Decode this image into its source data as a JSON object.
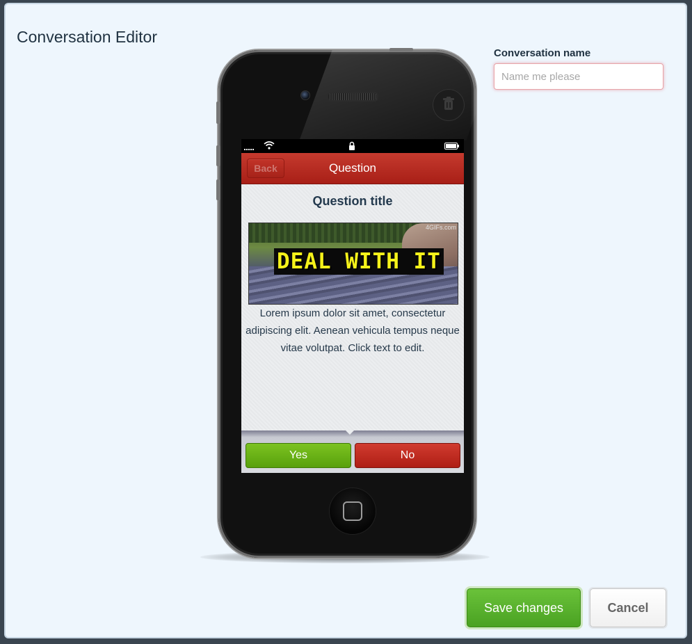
{
  "modal": {
    "title": "Conversation Editor"
  },
  "conversation_name": {
    "label": "Conversation name",
    "value": "",
    "placeholder": "Name me please"
  },
  "phone": {
    "nav": {
      "back_label": "Back",
      "title": "Question"
    },
    "question": {
      "title": "Question title",
      "gif": {
        "caption": "DEAL WITH IT",
        "watermark": "4GIFs.com"
      },
      "body": "Lorem ipsum dolor sit amet, consectetur adipiscing elit. Aenean vehicula tempus neque vitae volutpat. Click text to edit."
    },
    "choices": {
      "yes_label": "Yes",
      "no_label": "No"
    }
  },
  "actions": {
    "save_label": "Save changes",
    "cancel_label": "Cancel"
  },
  "colors": {
    "nav_red": "#b5271d",
    "yes_green": "#6ab41a",
    "no_red": "#c22a20",
    "save_green": "#56ad2c",
    "modal_bg": "#eef6fd"
  },
  "icons": {
    "trash": "trash-icon",
    "home": "home-button-icon",
    "signal": "signal-icon",
    "wifi": "wifi-icon",
    "lock": "lock-icon",
    "battery": "battery-icon"
  }
}
